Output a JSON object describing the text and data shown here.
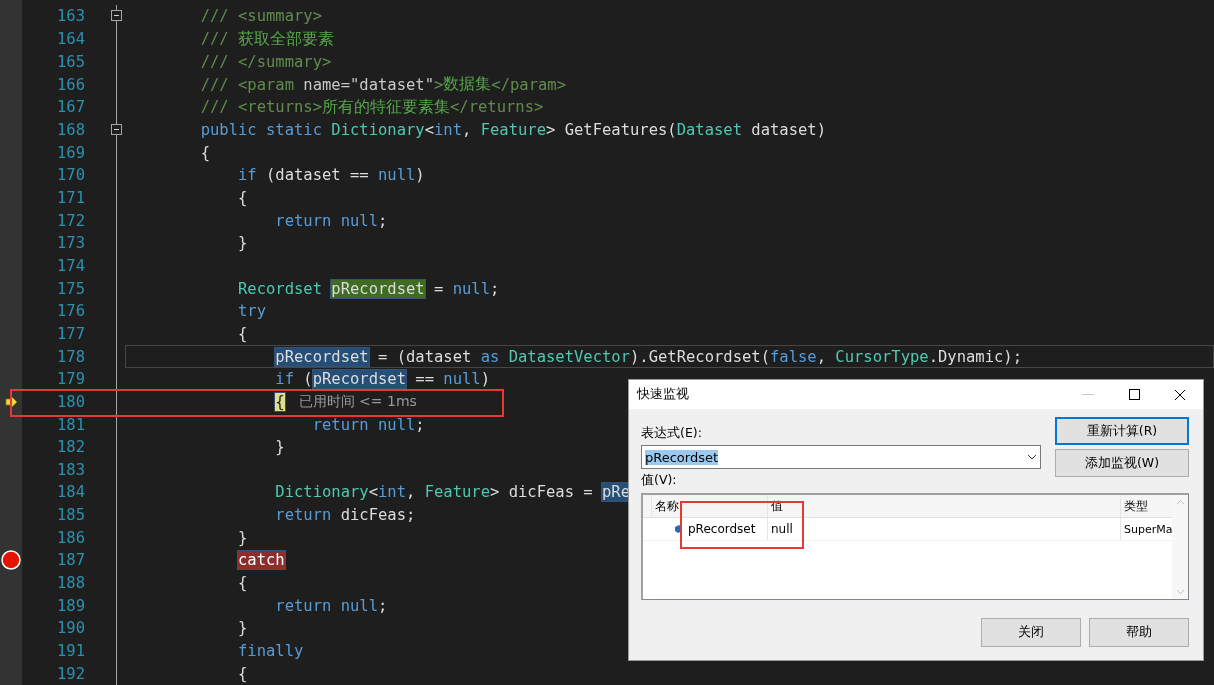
{
  "editor": {
    "lines": [
      {
        "number": "163",
        "kind": "code",
        "fold": true,
        "caret_line": false,
        "tokens": [
          {
            "kind": "doc",
            "text": "        /// <summary>"
          }
        ]
      },
      {
        "number": "164",
        "kind": "code",
        "fold": false,
        "caret_line": false,
        "tokens": [
          {
            "kind": "doc",
            "text": "        /// "
          },
          {
            "kind": "comment",
            "text": "获取全部要素"
          }
        ]
      },
      {
        "number": "165",
        "kind": "code",
        "fold": false,
        "caret_line": false,
        "tokens": [
          {
            "kind": "doc",
            "text": "        /// </summary>"
          }
        ]
      },
      {
        "number": "166",
        "kind": "code",
        "fold": false,
        "caret_line": false,
        "tokens": [
          {
            "kind": "doc",
            "text": "        /// <param "
          },
          {
            "kind": "doc-attr",
            "text": "name=\"dataset\""
          },
          {
            "kind": "doc",
            "text": ">"
          },
          {
            "kind": "comment",
            "text": "数据集"
          },
          {
            "kind": "doc",
            "text": "</param>"
          }
        ]
      },
      {
        "number": "167",
        "kind": "code",
        "fold": false,
        "caret_line": false,
        "tokens": [
          {
            "kind": "doc",
            "text": "        /// <returns>"
          },
          {
            "kind": "comment",
            "text": "所有的特征要素集"
          },
          {
            "kind": "doc",
            "text": "</returns>"
          }
        ]
      },
      {
        "number": "168",
        "kind": "code",
        "fold": true,
        "caret_line": false,
        "tokens": [
          {
            "kind": "keyword",
            "text": "        public static "
          },
          {
            "kind": "type",
            "text": "Dictionary"
          },
          {
            "kind": "plain",
            "text": "<"
          },
          {
            "kind": "keyword",
            "text": "int"
          },
          {
            "kind": "plain",
            "text": ", "
          },
          {
            "kind": "type",
            "text": "Feature"
          },
          {
            "kind": "plain",
            "text": "> GetFeatures("
          },
          {
            "kind": "type",
            "text": "Dataset"
          },
          {
            "kind": "plain",
            "text": " dataset)"
          }
        ]
      },
      {
        "number": "169",
        "kind": "code",
        "fold": false,
        "caret_line": false,
        "tokens": [
          {
            "kind": "plain",
            "text": "        {"
          }
        ]
      },
      {
        "number": "170",
        "kind": "code",
        "fold": false,
        "caret_line": false,
        "tokens": [
          {
            "kind": "keyword",
            "text": "            if"
          },
          {
            "kind": "plain",
            "text": " (dataset == "
          },
          {
            "kind": "keyword",
            "text": "null"
          },
          {
            "kind": "plain",
            "text": ")"
          }
        ]
      },
      {
        "number": "171",
        "kind": "code",
        "fold": false,
        "caret_line": false,
        "tokens": [
          {
            "kind": "plain",
            "text": "            {"
          }
        ]
      },
      {
        "number": "172",
        "kind": "code",
        "fold": false,
        "caret_line": false,
        "tokens": [
          {
            "kind": "keyword",
            "text": "                return null"
          },
          {
            "kind": "plain",
            "text": ";"
          }
        ]
      },
      {
        "number": "173",
        "kind": "code",
        "fold": false,
        "caret_line": false,
        "tokens": [
          {
            "kind": "plain",
            "text": "            }"
          }
        ]
      },
      {
        "number": "174",
        "kind": "code",
        "fold": false,
        "caret_line": false
      },
      {
        "number": "175",
        "kind": "code",
        "fold": false,
        "caret_line": false,
        "tokens": [
          {
            "kind": "type",
            "text": "            Recordset"
          },
          {
            "kind": "ref-def",
            "text": " pRecordset"
          },
          {
            "kind": "plain",
            "text": " = "
          },
          {
            "kind": "keyword",
            "text": "null"
          },
          {
            "kind": "plain",
            "text": ";"
          }
        ]
      },
      {
        "number": "176",
        "kind": "code",
        "fold": false,
        "caret_line": false,
        "tokens": [
          {
            "kind": "keyword",
            "text": "            try"
          }
        ]
      },
      {
        "number": "177",
        "kind": "code",
        "fold": false,
        "caret_line": false,
        "tokens": [
          {
            "kind": "plain",
            "text": "            {"
          }
        ]
      },
      {
        "number": "178",
        "kind": "code",
        "fold": false,
        "caret_line": true,
        "tokens": [
          {
            "kind": "ref",
            "text": "                pRecordset"
          },
          {
            "kind": "plain",
            "text": " = (dataset "
          },
          {
            "kind": "keyword",
            "text": "as"
          },
          {
            "kind": "type",
            "text": " DatasetVector"
          },
          {
            "kind": "plain",
            "text": ").GetRecordset("
          },
          {
            "kind": "keyword",
            "text": "false"
          },
          {
            "kind": "plain",
            "text": ", "
          },
          {
            "kind": "type",
            "text": "CursorType"
          },
          {
            "kind": "plain",
            "text": ".Dynamic);"
          }
        ]
      },
      {
        "number": "179",
        "kind": "code",
        "fold": false,
        "caret_line": false,
        "tokens": [
          {
            "kind": "keyword",
            "text": "                if"
          },
          {
            "kind": "plain",
            "text": " ("
          },
          {
            "kind": "ref",
            "text": "pRecordset"
          },
          {
            "kind": "plain",
            "text": " == "
          },
          {
            "kind": "keyword",
            "text": "null"
          },
          {
            "kind": "plain",
            "text": ")"
          }
        ]
      },
      {
        "number": "180",
        "kind": "current",
        "fold": false,
        "caret_line": false,
        "tokens": [
          {
            "kind": "current",
            "text": "                {"
          },
          {
            "kind": "perf-tip",
            "text": "已用时间 <= 1ms"
          }
        ]
      },
      {
        "number": "181",
        "kind": "code",
        "fold": false,
        "caret_line": false,
        "tokens": [
          {
            "kind": "keyword",
            "text": "                    return null"
          },
          {
            "kind": "plain",
            "text": ";"
          }
        ]
      },
      {
        "number": "182",
        "kind": "code",
        "fold": false,
        "caret_line": false,
        "tokens": [
          {
            "kind": "plain",
            "text": "                }"
          }
        ]
      },
      {
        "number": "183",
        "kind": "code",
        "fold": false,
        "caret_line": false
      },
      {
        "number": "184",
        "kind": "code",
        "fold": false,
        "caret_line": false,
        "tokens": [
          {
            "kind": "type",
            "text": "                Dictionary"
          },
          {
            "kind": "plain",
            "text": "<"
          },
          {
            "kind": "keyword",
            "text": "int"
          },
          {
            "kind": "plain",
            "text": ", "
          },
          {
            "kind": "type",
            "text": "Feature"
          },
          {
            "kind": "plain",
            "text": "> dicFeas = "
          },
          {
            "kind": "ref",
            "text": "pRe"
          }
        ]
      },
      {
        "number": "185",
        "kind": "code",
        "fold": false,
        "caret_line": false,
        "tokens": [
          {
            "kind": "keyword",
            "text": "                return"
          },
          {
            "kind": "plain",
            "text": " dicFeas;"
          }
        ]
      },
      {
        "number": "186",
        "kind": "code",
        "fold": false,
        "caret_line": false,
        "tokens": [
          {
            "kind": "plain",
            "text": "            }"
          }
        ]
      },
      {
        "number": "187",
        "kind": "breakpoint",
        "fold": false,
        "caret_line": false,
        "tokens": [
          {
            "kind": "breakpoint",
            "text": "            catch"
          }
        ]
      },
      {
        "number": "188",
        "kind": "code",
        "fold": false,
        "caret_line": false,
        "tokens": [
          {
            "kind": "plain",
            "text": "            {"
          }
        ]
      },
      {
        "number": "189",
        "kind": "code",
        "fold": false,
        "caret_line": false,
        "tokens": [
          {
            "kind": "keyword",
            "text": "                return null"
          },
          {
            "kind": "plain",
            "text": ";"
          }
        ]
      },
      {
        "number": "190",
        "kind": "code",
        "fold": false,
        "caret_line": false,
        "tokens": [
          {
            "kind": "plain",
            "text": "            }"
          }
        ]
      },
      {
        "number": "191",
        "kind": "code",
        "fold": false,
        "caret_line": false,
        "tokens": [
          {
            "kind": "keyword",
            "text": "            finally"
          }
        ]
      },
      {
        "number": "192",
        "kind": "code",
        "fold": false,
        "caret_line": false,
        "tokens": [
          {
            "kind": "plain",
            "text": "            {"
          }
        ]
      }
    ]
  },
  "quickwatch": {
    "title": "快速监视",
    "expression_label": "表达式(E):",
    "expression_value": "pRecordset",
    "value_label": "值(V):",
    "buttons": [
      {
        "label": "重新计算(R)",
        "default": true
      },
      {
        "label": "添加监视(W)",
        "default": false
      }
    ],
    "columns": [
      "名称",
      "值",
      "类型"
    ],
    "rows": [
      {
        "name": "pRecordset",
        "value": "null",
        "type": "SuperMa"
      }
    ],
    "footer_buttons": [
      "关闭",
      "帮助"
    ]
  }
}
